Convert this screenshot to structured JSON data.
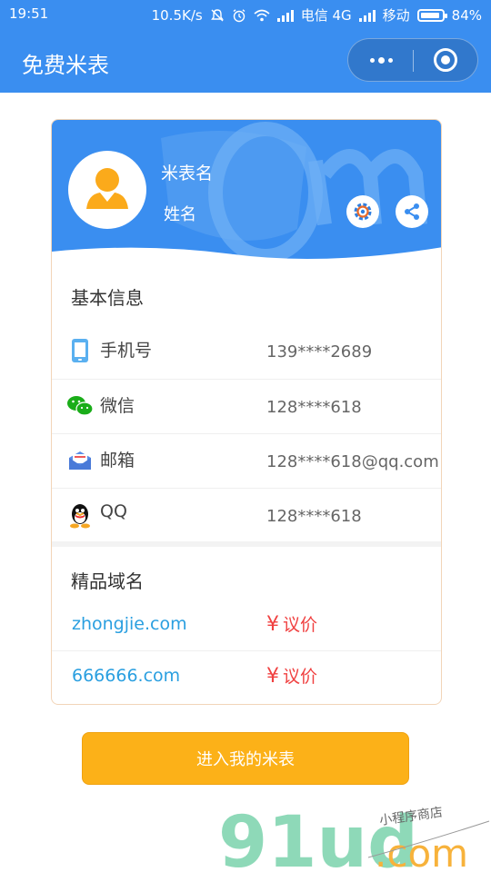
{
  "status_bar": {
    "time": "19:51",
    "net_speed": "10.5K/s",
    "carrier1": "电信 4G",
    "carrier2": "移动",
    "battery": "84%"
  },
  "nav": {
    "title": "免费米表"
  },
  "profile": {
    "meter_name": "米表名",
    "person_name": "姓名"
  },
  "basic_info": {
    "title": "基本信息",
    "rows": [
      {
        "label": "手机号",
        "value": "139****2689",
        "icon": "phone-icon"
      },
      {
        "label": "微信",
        "value": "128****618",
        "icon": "wechat-icon"
      },
      {
        "label": "邮箱",
        "value": "128****618@qq.com",
        "icon": "mail-icon"
      },
      {
        "label": "QQ",
        "value": "128****618",
        "icon": "qq-icon"
      }
    ]
  },
  "domains": {
    "title": "精品域名",
    "items": [
      {
        "name": "zhongjie.com",
        "price": "议价",
        "currency": "¥"
      },
      {
        "name": "666666.com",
        "price": "议价",
        "currency": "¥"
      }
    ]
  },
  "enter_button": "进入我的米表",
  "watermark": {
    "brand": "91ud",
    "suffix": ".com",
    "tagline": "小程序商店"
  },
  "colors": {
    "primary": "#3a8ef0",
    "accent": "#fcb118",
    "price": "#f04040",
    "link": "#2a9fe0"
  }
}
